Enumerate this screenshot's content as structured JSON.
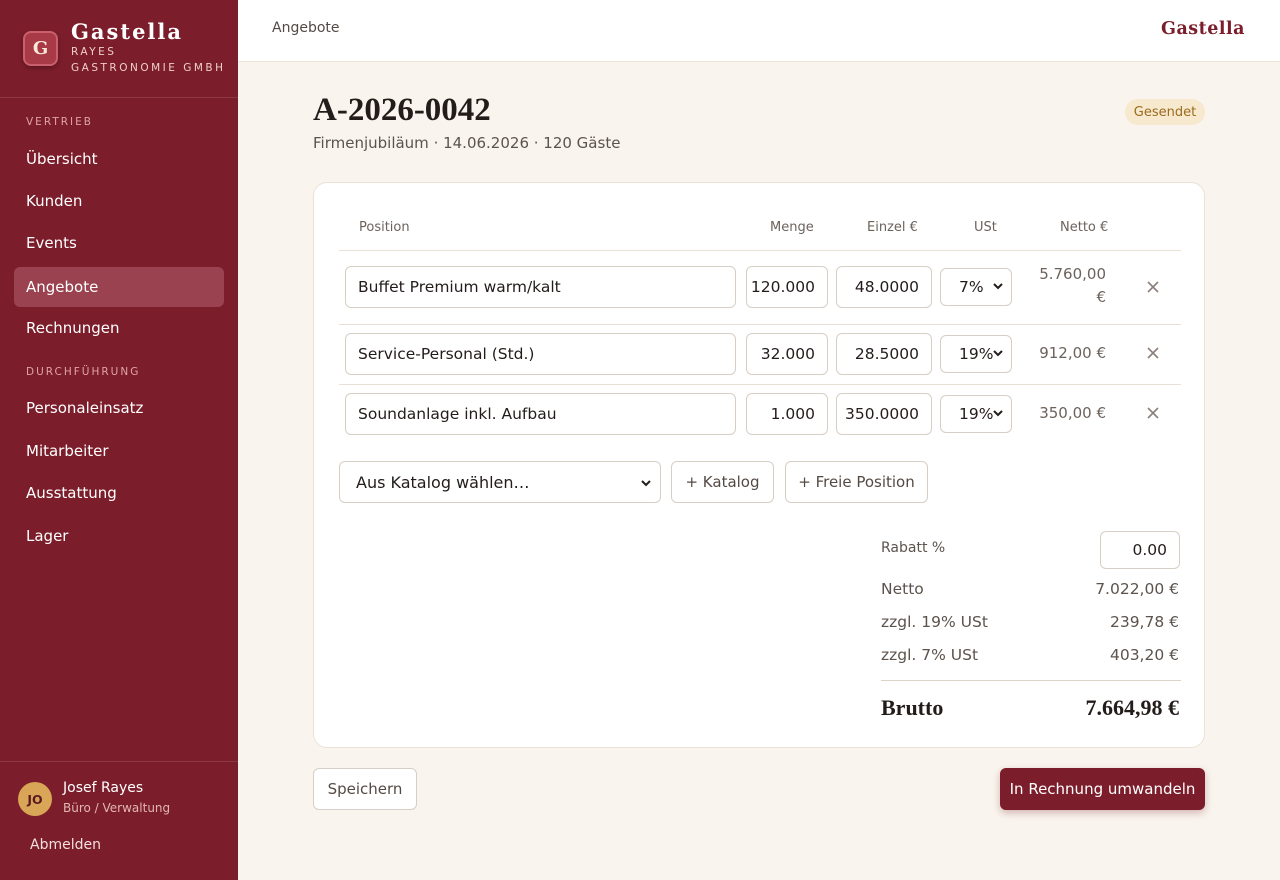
{
  "brand": {
    "logo_letter": "G",
    "name": "Gastella",
    "sub_line1": "RAYES",
    "sub_line2": "GASTRONOMIE GMBH"
  },
  "sidebar": {
    "section_sales": "VERTRIEB",
    "section_ops": "DURCHFÜHRUNG",
    "items": [
      {
        "label": "Übersicht"
      },
      {
        "label": "Kunden"
      },
      {
        "label": "Events"
      },
      {
        "label": "Angebote",
        "active": true
      },
      {
        "label": "Rechnungen"
      },
      {
        "label": "Personaleinsatz"
      },
      {
        "label": "Mitarbeiter"
      },
      {
        "label": "Ausstattung"
      },
      {
        "label": "Lager"
      }
    ]
  },
  "user": {
    "initials": "JO",
    "name": "Josef Rayes",
    "role": "Büro / Verwaltung",
    "logout_label": "Abmelden"
  },
  "topbar": {
    "breadcrumb": "Angebote",
    "brand": "Gastella"
  },
  "offer": {
    "number": "A-2026-0042",
    "subtitle": "Firmenjubiläum · 14.06.2026 · 120 Gäste",
    "status": "Gesendet"
  },
  "table": {
    "headers": {
      "position": "Position",
      "quantity": "Menge",
      "unit_price": "Einzel €",
      "vat": "USt",
      "net": "Netto €"
    },
    "rows": [
      {
        "position": "Buffet Premium warm/kalt",
        "quantity": "120.000",
        "unit_price": "48.0000",
        "vat": "7%",
        "net_line1": "5.760,00",
        "net_line2": "€"
      },
      {
        "position": "Service-Personal (Std.)",
        "quantity": "32.000",
        "unit_price": "28.5000",
        "vat": "19%",
        "net_line1": "912,00 €",
        "net_line2": ""
      },
      {
        "position": "Soundanlage inkl. Aufbau",
        "quantity": "1.000",
        "unit_price": "350.0000",
        "vat": "19%",
        "net_line1": "350,00 €",
        "net_line2": ""
      }
    ]
  },
  "actions": {
    "catalog_select": "Aus Katalog wählen…",
    "add_catalog": "+ Katalog",
    "add_free": "+ Freie Position"
  },
  "totals": {
    "discount_label": "Rabatt %",
    "discount_value": "0.00",
    "net_label": "Netto",
    "net_value": "7.022,00 €",
    "vat19_label": "zzgl. 19% USt",
    "vat19_value": "239,78 €",
    "vat7_label": "zzgl. 7% USt",
    "vat7_value": "403,20 €",
    "gross_label": "Brutto",
    "gross_value": "7.664,98 €"
  },
  "footer": {
    "save_label": "Speichern",
    "convert_label": "In Rechnung umwandeln"
  },
  "colors": {
    "brand": "#7b1d2a",
    "badge_bg": "#f6e9cd",
    "badge_text": "#9c6b20",
    "background": "#f9f5ee"
  }
}
